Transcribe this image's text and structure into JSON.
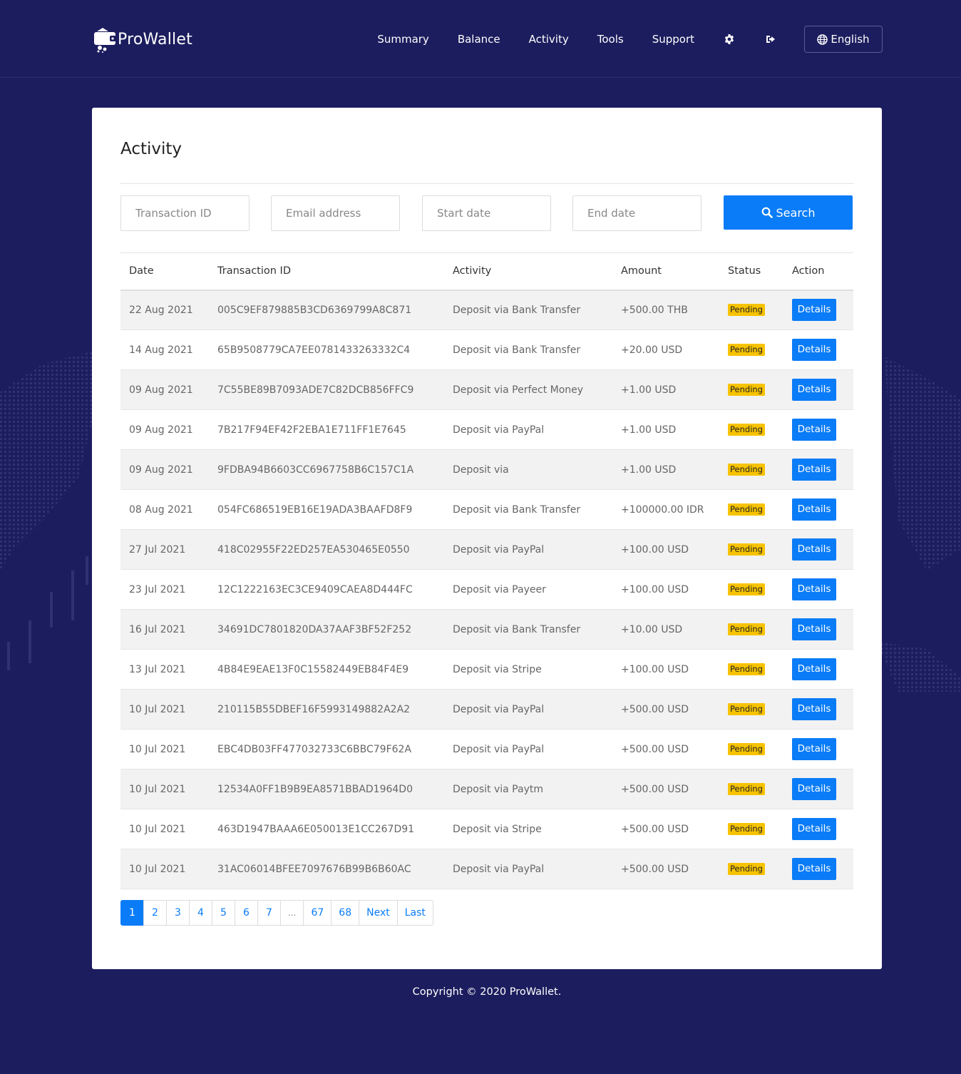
{
  "brand": {
    "name": "ProWallet"
  },
  "nav": {
    "links": [
      "Summary",
      "Balance",
      "Activity",
      "Tools",
      "Support"
    ],
    "language": "English"
  },
  "page": {
    "title": "Activity"
  },
  "filters": {
    "transaction_id_placeholder": "Transaction ID",
    "email_placeholder": "Email address",
    "start_date_placeholder": "Start date",
    "end_date_placeholder": "End date",
    "search_label": "Search"
  },
  "table": {
    "columns": [
      "Date",
      "Transaction ID",
      "Activity",
      "Amount",
      "Status",
      "Action"
    ],
    "rows": [
      {
        "date": "22 Aug 2021",
        "id": "005C9EF879885B3CD6369799A8C871",
        "activity": "Deposit via Bank Transfer",
        "amount": "+500.00 THB",
        "status": "Pending",
        "action": "Details"
      },
      {
        "date": "14 Aug 2021",
        "id": "65B9508779CA7EE0781433263332C4",
        "activity": "Deposit via Bank Transfer",
        "amount": "+20.00 USD",
        "status": "Pending",
        "action": "Details"
      },
      {
        "date": "09 Aug 2021",
        "id": "7C55BE89B7093ADE7C82DCB856FFC9",
        "activity": "Deposit via Perfect Money",
        "amount": "+1.00 USD",
        "status": "Pending",
        "action": "Details"
      },
      {
        "date": "09 Aug 2021",
        "id": "7B217F94EF42F2EBA1E711FF1E7645",
        "activity": "Deposit via PayPal",
        "amount": "+1.00 USD",
        "status": "Pending",
        "action": "Details"
      },
      {
        "date": "09 Aug 2021",
        "id": "9FDBA94B6603CC6967758B6C157C1A",
        "activity": "Deposit via",
        "amount": "+1.00 USD",
        "status": "Pending",
        "action": "Details"
      },
      {
        "date": "08 Aug 2021",
        "id": "054FC686519EB16E19ADA3BAAFD8F9",
        "activity": "Deposit via Bank Transfer",
        "amount": "+100000.00 IDR",
        "status": "Pending",
        "action": "Details"
      },
      {
        "date": "27 Jul 2021",
        "id": "418C02955F22ED257EA530465E0550",
        "activity": "Deposit via PayPal",
        "amount": "+100.00 USD",
        "status": "Pending",
        "action": "Details"
      },
      {
        "date": "23 Jul 2021",
        "id": "12C1222163EC3CE9409CAEA8D444FC",
        "activity": "Deposit via Payeer",
        "amount": "+100.00 USD",
        "status": "Pending",
        "action": "Details"
      },
      {
        "date": "16 Jul 2021",
        "id": "34691DC7801820DA37AAF3BF52F252",
        "activity": "Deposit via Bank Transfer",
        "amount": "+10.00 USD",
        "status": "Pending",
        "action": "Details"
      },
      {
        "date": "13 Jul 2021",
        "id": "4B84E9EAE13F0C15582449EB84F4E9",
        "activity": "Deposit via Stripe",
        "amount": "+100.00 USD",
        "status": "Pending",
        "action": "Details"
      },
      {
        "date": "10 Jul 2021",
        "id": "210115B55DBEF16F5993149882A2A2",
        "activity": "Deposit via PayPal",
        "amount": "+500.00 USD",
        "status": "Pending",
        "action": "Details"
      },
      {
        "date": "10 Jul 2021",
        "id": "EBC4DB03FF477032733C6BBC79F62A",
        "activity": "Deposit via PayPal",
        "amount": "+500.00 USD",
        "status": "Pending",
        "action": "Details"
      },
      {
        "date": "10 Jul 2021",
        "id": "12534A0FF1B9B9EA8571BBAD1964D0",
        "activity": "Deposit via Paytm",
        "amount": "+500.00 USD",
        "status": "Pending",
        "action": "Details"
      },
      {
        "date": "10 Jul 2021",
        "id": "463D1947BAAA6E050013E1CC267D91",
        "activity": "Deposit via Stripe",
        "amount": "+500.00 USD",
        "status": "Pending",
        "action": "Details"
      },
      {
        "date": "10 Jul 2021",
        "id": "31AC06014BFEE7097676B99B6B60AC",
        "activity": "Deposit via PayPal",
        "amount": "+500.00 USD",
        "status": "Pending",
        "action": "Details"
      }
    ]
  },
  "pagination": {
    "items": [
      "1",
      "2",
      "3",
      "4",
      "5",
      "6",
      "7",
      "...",
      "67",
      "68",
      "Next",
      "Last"
    ],
    "active": "1"
  },
  "footer": {
    "copyright": "Copyright © 2020 ProWallet."
  },
  "colors": {
    "background": "#1c1d5e",
    "primary": "#0a7cf7",
    "pending": "#f7c300"
  }
}
